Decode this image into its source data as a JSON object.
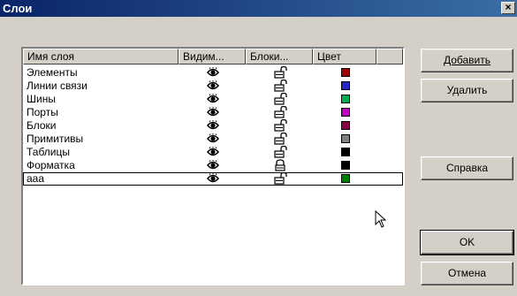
{
  "window": {
    "title": "Слои",
    "close_glyph": "×"
  },
  "listview": {
    "columns": [
      "Имя слоя",
      "Видим...",
      "Блоки...",
      "Цвет"
    ],
    "rows": [
      {
        "name": "Элементы",
        "visible": true,
        "locked": false,
        "color": "#a00000"
      },
      {
        "name": "Линии связи",
        "visible": true,
        "locked": false,
        "color": "#2828c8"
      },
      {
        "name": "Шины",
        "visible": true,
        "locked": false,
        "color": "#00b050"
      },
      {
        "name": "Порты",
        "visible": true,
        "locked": false,
        "color": "#c000c0"
      },
      {
        "name": "Блоки",
        "visible": true,
        "locked": false,
        "color": "#8b0045"
      },
      {
        "name": "Примитивы",
        "visible": true,
        "locked": false,
        "color": "#808080"
      },
      {
        "name": "Таблицы",
        "visible": true,
        "locked": false,
        "color": "#000000"
      },
      {
        "name": "Форматка",
        "visible": true,
        "locked": true,
        "color": "#000000"
      },
      {
        "name": "ааа",
        "visible": true,
        "locked": false,
        "color": "#008000"
      }
    ],
    "selected_index": 8
  },
  "buttons": {
    "add": "Добавить",
    "delete": "Удалить",
    "help": "Справка",
    "ok": "OK",
    "cancel": "Отмена"
  }
}
